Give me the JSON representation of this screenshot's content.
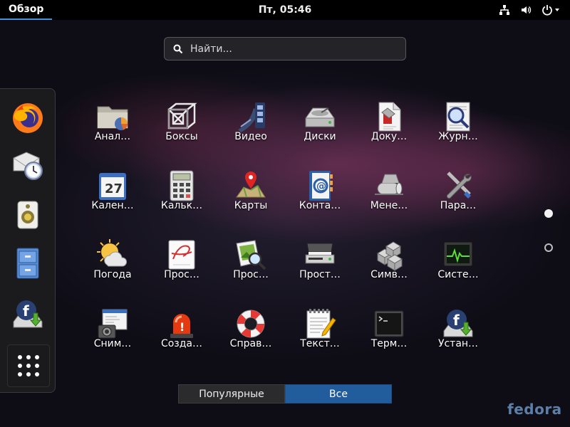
{
  "topbar": {
    "activities": "Обзор",
    "clock": "Пт, 05:46",
    "icons": [
      "network-wired-icon",
      "volume-icon",
      "power-icon"
    ]
  },
  "search": {
    "placeholder": "Найти..."
  },
  "dash": {
    "apps": [
      {
        "name": "firefox",
        "icon": "firefox-icon"
      },
      {
        "name": "evolution",
        "icon": "mail-clock-icon"
      },
      {
        "name": "rhythmbox",
        "icon": "speaker-icon"
      },
      {
        "name": "files",
        "icon": "file-cabinet-icon"
      },
      {
        "name": "fedora-install",
        "icon": "fedora-install-icon"
      }
    ],
    "show_apps_icon": "show-apps-grid-icon"
  },
  "apps": [
    {
      "label": "Анал…",
      "icon": "disk-usage-folder-icon"
    },
    {
      "label": "Боксы",
      "icon": "boxes-icon"
    },
    {
      "label": "Видео",
      "icon": "video-film-icon"
    },
    {
      "label": "Диски",
      "icon": "disks-icon"
    },
    {
      "label": "Доку…",
      "icon": "document-viewer-icon"
    },
    {
      "label": "Журн…",
      "icon": "logs-magnifier-icon"
    },
    {
      "label": "Кален…",
      "icon": "calendar-icon"
    },
    {
      "label": "Кальк…",
      "icon": "calculator-icon"
    },
    {
      "label": "Карты",
      "icon": "maps-pin-icon"
    },
    {
      "label": "Конта…",
      "icon": "contacts-icon"
    },
    {
      "label": "Мене…",
      "icon": "package-manager-icon"
    },
    {
      "label": "Пара…",
      "icon": "settings-tools-icon"
    },
    {
      "label": "Погода",
      "icon": "weather-icon"
    },
    {
      "label": "Прос…",
      "icon": "font-viewer-icon"
    },
    {
      "label": "Прос…",
      "icon": "image-viewer-icon"
    },
    {
      "label": "Прост…",
      "icon": "scanner-icon"
    },
    {
      "label": "Симв…",
      "icon": "characters-icon"
    },
    {
      "label": "Систе…",
      "icon": "system-monitor-icon"
    },
    {
      "label": "Сним…",
      "icon": "screenshot-icon"
    },
    {
      "label": "Созда…",
      "icon": "alarm-light-icon"
    },
    {
      "label": "Справ…",
      "icon": "help-lifebuoy-icon"
    },
    {
      "label": "Текст…",
      "icon": "text-editor-icon"
    },
    {
      "label": "Терм…",
      "icon": "terminal-icon"
    },
    {
      "label": "Устан…",
      "icon": "fedora-install-icon"
    }
  ],
  "pages": {
    "current": 1,
    "total": 2
  },
  "view_switch": {
    "frequent": "Популярные",
    "all": "Все",
    "selected": "all"
  },
  "watermark": "fedora",
  "colors": {
    "accent": "#215d9c",
    "topbar": "#000000",
    "fedora_blue": "#5c7fa8"
  }
}
